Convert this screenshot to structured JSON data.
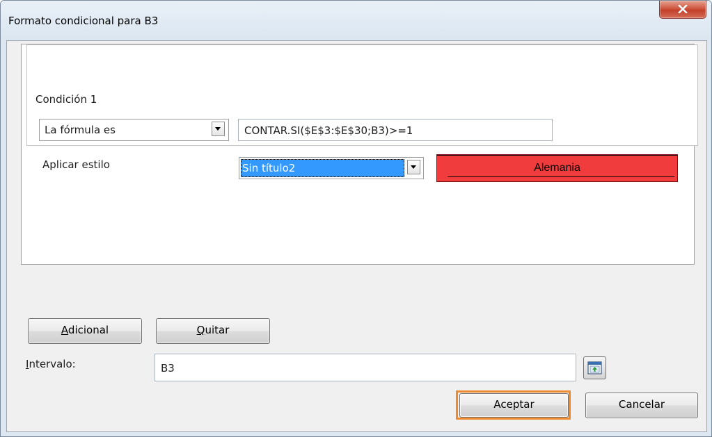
{
  "dialog": {
    "title": "Formato condicional para B3"
  },
  "condition": {
    "heading": "Condición 1",
    "type_value": "La fórmula es",
    "formula": "CONTAR.SI($E$3:$E$30;B3)>=1",
    "apply_style_label": "Aplicar estilo",
    "style_value": "Sin título2",
    "preview_text": "Alemania"
  },
  "buttons": {
    "additional_pre": "",
    "additional_mnemonic": "A",
    "additional_rest": "dicional",
    "remove_mnemonic": "Q",
    "remove_rest": "uitar",
    "ok": "Aceptar",
    "cancel": "Cancelar"
  },
  "range": {
    "label_mnemonic": "I",
    "label_rest": "ntervalo:",
    "value": "B3"
  },
  "icons": {
    "close": "close-icon",
    "shrink": "shrink-range-icon",
    "dropdown": "chevron-down-icon"
  },
  "colors": {
    "preview_bg": "#f03c3c",
    "focus": "#f08a2c",
    "close_bg": "#c2402a",
    "highlight": "#3399ff"
  }
}
